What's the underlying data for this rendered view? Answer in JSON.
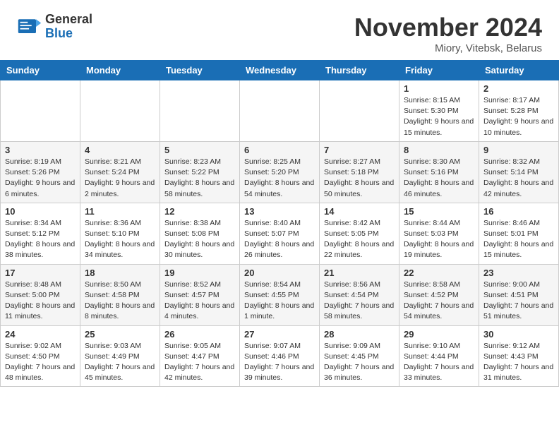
{
  "header": {
    "logo_general": "General",
    "logo_blue": "Blue",
    "month_title": "November 2024",
    "location": "Miory, Vitebsk, Belarus"
  },
  "weekdays": [
    "Sunday",
    "Monday",
    "Tuesday",
    "Wednesday",
    "Thursday",
    "Friday",
    "Saturday"
  ],
  "rows": [
    [
      {
        "day": "",
        "info": ""
      },
      {
        "day": "",
        "info": ""
      },
      {
        "day": "",
        "info": ""
      },
      {
        "day": "",
        "info": ""
      },
      {
        "day": "",
        "info": ""
      },
      {
        "day": "1",
        "info": "Sunrise: 8:15 AM\nSunset: 5:30 PM\nDaylight: 9 hours and 15 minutes."
      },
      {
        "day": "2",
        "info": "Sunrise: 8:17 AM\nSunset: 5:28 PM\nDaylight: 9 hours and 10 minutes."
      }
    ],
    [
      {
        "day": "3",
        "info": "Sunrise: 8:19 AM\nSunset: 5:26 PM\nDaylight: 9 hours and 6 minutes."
      },
      {
        "day": "4",
        "info": "Sunrise: 8:21 AM\nSunset: 5:24 PM\nDaylight: 9 hours and 2 minutes."
      },
      {
        "day": "5",
        "info": "Sunrise: 8:23 AM\nSunset: 5:22 PM\nDaylight: 8 hours and 58 minutes."
      },
      {
        "day": "6",
        "info": "Sunrise: 8:25 AM\nSunset: 5:20 PM\nDaylight: 8 hours and 54 minutes."
      },
      {
        "day": "7",
        "info": "Sunrise: 8:27 AM\nSunset: 5:18 PM\nDaylight: 8 hours and 50 minutes."
      },
      {
        "day": "8",
        "info": "Sunrise: 8:30 AM\nSunset: 5:16 PM\nDaylight: 8 hours and 46 minutes."
      },
      {
        "day": "9",
        "info": "Sunrise: 8:32 AM\nSunset: 5:14 PM\nDaylight: 8 hours and 42 minutes."
      }
    ],
    [
      {
        "day": "10",
        "info": "Sunrise: 8:34 AM\nSunset: 5:12 PM\nDaylight: 8 hours and 38 minutes."
      },
      {
        "day": "11",
        "info": "Sunrise: 8:36 AM\nSunset: 5:10 PM\nDaylight: 8 hours and 34 minutes."
      },
      {
        "day": "12",
        "info": "Sunrise: 8:38 AM\nSunset: 5:08 PM\nDaylight: 8 hours and 30 minutes."
      },
      {
        "day": "13",
        "info": "Sunrise: 8:40 AM\nSunset: 5:07 PM\nDaylight: 8 hours and 26 minutes."
      },
      {
        "day": "14",
        "info": "Sunrise: 8:42 AM\nSunset: 5:05 PM\nDaylight: 8 hours and 22 minutes."
      },
      {
        "day": "15",
        "info": "Sunrise: 8:44 AM\nSunset: 5:03 PM\nDaylight: 8 hours and 19 minutes."
      },
      {
        "day": "16",
        "info": "Sunrise: 8:46 AM\nSunset: 5:01 PM\nDaylight: 8 hours and 15 minutes."
      }
    ],
    [
      {
        "day": "17",
        "info": "Sunrise: 8:48 AM\nSunset: 5:00 PM\nDaylight: 8 hours and 11 minutes."
      },
      {
        "day": "18",
        "info": "Sunrise: 8:50 AM\nSunset: 4:58 PM\nDaylight: 8 hours and 8 minutes."
      },
      {
        "day": "19",
        "info": "Sunrise: 8:52 AM\nSunset: 4:57 PM\nDaylight: 8 hours and 4 minutes."
      },
      {
        "day": "20",
        "info": "Sunrise: 8:54 AM\nSunset: 4:55 PM\nDaylight: 8 hours and 1 minute."
      },
      {
        "day": "21",
        "info": "Sunrise: 8:56 AM\nSunset: 4:54 PM\nDaylight: 7 hours and 58 minutes."
      },
      {
        "day": "22",
        "info": "Sunrise: 8:58 AM\nSunset: 4:52 PM\nDaylight: 7 hours and 54 minutes."
      },
      {
        "day": "23",
        "info": "Sunrise: 9:00 AM\nSunset: 4:51 PM\nDaylight: 7 hours and 51 minutes."
      }
    ],
    [
      {
        "day": "24",
        "info": "Sunrise: 9:02 AM\nSunset: 4:50 PM\nDaylight: 7 hours and 48 minutes."
      },
      {
        "day": "25",
        "info": "Sunrise: 9:03 AM\nSunset: 4:49 PM\nDaylight: 7 hours and 45 minutes."
      },
      {
        "day": "26",
        "info": "Sunrise: 9:05 AM\nSunset: 4:47 PM\nDaylight: 7 hours and 42 minutes."
      },
      {
        "day": "27",
        "info": "Sunrise: 9:07 AM\nSunset: 4:46 PM\nDaylight: 7 hours and 39 minutes."
      },
      {
        "day": "28",
        "info": "Sunrise: 9:09 AM\nSunset: 4:45 PM\nDaylight: 7 hours and 36 minutes."
      },
      {
        "day": "29",
        "info": "Sunrise: 9:10 AM\nSunset: 4:44 PM\nDaylight: 7 hours and 33 minutes."
      },
      {
        "day": "30",
        "info": "Sunrise: 9:12 AM\nSunset: 4:43 PM\nDaylight: 7 hours and 31 minutes."
      }
    ]
  ]
}
